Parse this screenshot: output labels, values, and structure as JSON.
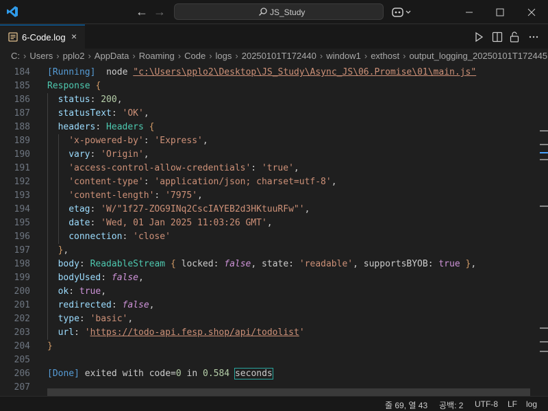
{
  "titlebar": {
    "search_text": "JS_Study"
  },
  "tab": {
    "label": "6-Code.log",
    "close": "×"
  },
  "breadcrumb": [
    "C:",
    "Users",
    "pplo2",
    "AppData",
    "Roaming",
    "Code",
    "logs",
    "20250101T172440",
    "window1",
    "exthost",
    "output_logging_20250101T172445"
  ],
  "editor": {
    "lines": [
      {
        "n": "184",
        "indent": 0,
        "segs": [
          [
            "mark",
            "[Running]"
          ],
          [
            "",
            "  node "
          ],
          [
            "path",
            "\"c:\\Users\\pplo2\\Desktop\\JS_Study\\Async_JS\\06.Promise\\01\\main.js\""
          ]
        ]
      },
      {
        "n": "185",
        "indent": 0,
        "segs": [
          [
            "ty",
            "Response"
          ],
          [
            "",
            " "
          ],
          [
            "brk",
            "{"
          ]
        ]
      },
      {
        "n": "186",
        "indent": 1,
        "segs": [
          [
            "prop",
            "status"
          ],
          [
            "",
            ": "
          ],
          [
            "num",
            "200"
          ],
          [
            "",
            ","
          ]
        ]
      },
      {
        "n": "187",
        "indent": 1,
        "segs": [
          [
            "prop",
            "statusText"
          ],
          [
            "",
            ": "
          ],
          [
            "str",
            "'OK'"
          ],
          [
            "",
            ","
          ]
        ]
      },
      {
        "n": "188",
        "indent": 1,
        "segs": [
          [
            "prop",
            "headers"
          ],
          [
            "",
            ": "
          ],
          [
            "ty",
            "Headers"
          ],
          [
            "",
            " "
          ],
          [
            "brk",
            "{"
          ]
        ]
      },
      {
        "n": "189",
        "indent": 2,
        "segs": [
          [
            "str",
            "'x-powered-by'"
          ],
          [
            "",
            ": "
          ],
          [
            "str",
            "'Express'"
          ],
          [
            "",
            ","
          ]
        ]
      },
      {
        "n": "190",
        "indent": 2,
        "segs": [
          [
            "prop",
            "vary"
          ],
          [
            "",
            ": "
          ],
          [
            "str",
            "'Origin'"
          ],
          [
            "",
            ","
          ]
        ]
      },
      {
        "n": "191",
        "indent": 2,
        "segs": [
          [
            "str",
            "'access-control-allow-credentials'"
          ],
          [
            "",
            ": "
          ],
          [
            "str",
            "'true'"
          ],
          [
            "",
            ","
          ]
        ]
      },
      {
        "n": "192",
        "indent": 2,
        "segs": [
          [
            "str",
            "'content-type'"
          ],
          [
            "",
            ": "
          ],
          [
            "str",
            "'application/json; charset=utf-8'"
          ],
          [
            "",
            ","
          ]
        ]
      },
      {
        "n": "193",
        "indent": 2,
        "segs": [
          [
            "str",
            "'content-length'"
          ],
          [
            "",
            ": "
          ],
          [
            "str",
            "'7975'"
          ],
          [
            "",
            ","
          ]
        ]
      },
      {
        "n": "194",
        "indent": 2,
        "segs": [
          [
            "prop",
            "etag"
          ],
          [
            "",
            ": "
          ],
          [
            "str",
            "'W/\"1f27-ZOG9INq2CscIAYEB2d3HKtuuRFw\"'"
          ],
          [
            "",
            ","
          ]
        ]
      },
      {
        "n": "195",
        "indent": 2,
        "segs": [
          [
            "prop",
            "date"
          ],
          [
            "",
            ": "
          ],
          [
            "str",
            "'Wed, 01 Jan 2025 11:03:26 GMT'"
          ],
          [
            "",
            ","
          ]
        ]
      },
      {
        "n": "196",
        "indent": 2,
        "segs": [
          [
            "prop",
            "connection"
          ],
          [
            "",
            ": "
          ],
          [
            "str",
            "'close'"
          ]
        ]
      },
      {
        "n": "197",
        "indent": 1,
        "segs": [
          [
            "brk",
            "}"
          ],
          [
            "",
            ","
          ]
        ]
      },
      {
        "n": "198",
        "indent": 1,
        "segs": [
          [
            "prop",
            "body"
          ],
          [
            "",
            ": "
          ],
          [
            "ty",
            "ReadableStream"
          ],
          [
            "",
            " "
          ],
          [
            "brk",
            "{"
          ],
          [
            "",
            " locked: "
          ],
          [
            "bool-i",
            "false"
          ],
          [
            "",
            ", state: "
          ],
          [
            "str",
            "'readable'"
          ],
          [
            "",
            ", supportsBYOB: "
          ],
          [
            "bool",
            "true"
          ],
          [
            "",
            " "
          ],
          [
            "brk",
            "}"
          ],
          [
            "",
            ","
          ]
        ]
      },
      {
        "n": "199",
        "indent": 1,
        "segs": [
          [
            "prop",
            "bodyUsed"
          ],
          [
            "",
            ": "
          ],
          [
            "bool-i",
            "false"
          ],
          [
            "",
            ","
          ]
        ]
      },
      {
        "n": "200",
        "indent": 1,
        "segs": [
          [
            "prop",
            "ok"
          ],
          [
            "",
            ": "
          ],
          [
            "bool",
            "true"
          ],
          [
            "",
            ","
          ]
        ]
      },
      {
        "n": "201",
        "indent": 1,
        "segs": [
          [
            "prop",
            "redirected"
          ],
          [
            "",
            ": "
          ],
          [
            "bool-i",
            "false"
          ],
          [
            "",
            ","
          ]
        ]
      },
      {
        "n": "202",
        "indent": 1,
        "segs": [
          [
            "prop",
            "type"
          ],
          [
            "",
            ": "
          ],
          [
            "str",
            "'basic'"
          ],
          [
            "",
            ","
          ]
        ]
      },
      {
        "n": "203",
        "indent": 1,
        "segs": [
          [
            "prop",
            "url"
          ],
          [
            "",
            ": "
          ],
          [
            "str",
            "'"
          ],
          [
            "path",
            "https://todo-api.fesp.shop/api/todolist"
          ],
          [
            "str",
            "'"
          ]
        ]
      },
      {
        "n": "204",
        "indent": 0,
        "segs": [
          [
            "brk",
            "}"
          ]
        ]
      },
      {
        "n": "205",
        "indent": 0,
        "segs": []
      },
      {
        "n": "206",
        "indent": 0,
        "segs": [
          [
            "mark",
            "[Done]"
          ],
          [
            "",
            " exited with code="
          ],
          [
            "num",
            "0"
          ],
          [
            "",
            " in "
          ],
          [
            "num",
            "0.584"
          ],
          [
            "",
            " "
          ],
          [
            "hl",
            "seconds"
          ]
        ]
      },
      {
        "n": "207",
        "indent": 0,
        "segs": []
      }
    ]
  },
  "statusbar": {
    "position": "줄 69, 열 43",
    "spaces": "공백: 2",
    "encoding": "UTF-8",
    "eol": "LF",
    "language": "log"
  },
  "colors": {
    "accent": "#0078d4",
    "background": "#1f1f1f"
  }
}
